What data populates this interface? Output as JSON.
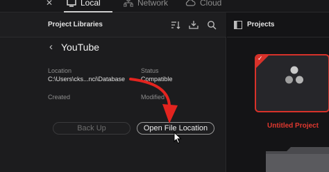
{
  "tabs": {
    "local": "Local",
    "network": "Network",
    "cloud": "Cloud"
  },
  "left_panel": {
    "title": "Project Libraries",
    "library_name": "YouTube",
    "location_label": "Location",
    "location_value": "C:\\Users\\cks...nci\\Database",
    "status_label": "Status",
    "status_value": "Compatible",
    "created_label": "Created",
    "modified_label": "Modified",
    "back_up_button": "Back Up",
    "open_file_location_button": "Open File Location"
  },
  "right_panel": {
    "title": "Projects",
    "project_name": "Untitled Project"
  },
  "colors": {
    "accent_red": "#d8322a",
    "annotation_red": "#e3241f"
  }
}
